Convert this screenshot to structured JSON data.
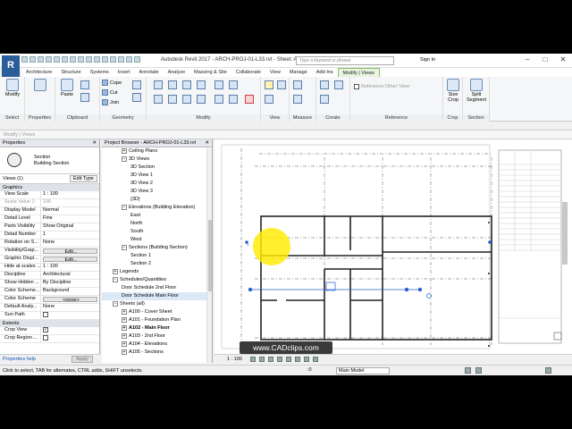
{
  "app": {
    "title": "Autodesk Revit 2017 -  ARCH-PROJ-01-L33.rvt - Sheet: A102 - Main Floor",
    "logo": "R",
    "search_placeholder": "Type a keyword or phrase",
    "sign_in": "Sign In",
    "window_controls": [
      "–",
      "□",
      "✕"
    ]
  },
  "ribbon": {
    "tabs": [
      "Architecture",
      "Structure",
      "Systems",
      "Insert",
      "Annotate",
      "Analyze",
      "Massing & Site",
      "Collaborate",
      "View",
      "Manage",
      "Add-Ins",
      "Modify | Views"
    ],
    "active_tab": "Modify | Views",
    "panels": {
      "select": "Select",
      "properties": "Properties",
      "clipboard": "Clipboard",
      "geometry": "Geometry",
      "modify": "Modify",
      "view": "View",
      "measure": "Measure",
      "create": "Create",
      "reference": "Reference",
      "crop": "Crop",
      "section": "Section"
    },
    "buttons": {
      "modify": "Modify",
      "paste": "Paste",
      "cope": "Cope",
      "cut": "Cut",
      "join": "Join",
      "reference_other_view": "Reference Other View",
      "size_crop": "Size Crop",
      "split_segment": "Split Segment"
    }
  },
  "modify_views_label": "Modify | Views",
  "properties": {
    "header": "Properties",
    "type_name": "Section",
    "type_sub": "Building Section",
    "view_selector": "Views (1)",
    "edit_type": "Edit Type",
    "rows": [
      {
        "k": "Graphics",
        "section": true
      },
      {
        "k": "View Scale",
        "v": "1 : 100"
      },
      {
        "k": "Scale Value   1:",
        "v": "100",
        "grey": true
      },
      {
        "k": "Display Model",
        "v": "Normal"
      },
      {
        "k": "Detail Level",
        "v": "Fine"
      },
      {
        "k": "Parts Visibility",
        "v": "Show Original"
      },
      {
        "k": "Detail Number",
        "v": "1"
      },
      {
        "k": "Rotation on S...",
        "v": "None"
      },
      {
        "k": "Visibility/Grap...",
        "v": "Edit...",
        "btn": true
      },
      {
        "k": "Graphic Displ...",
        "v": "Edit...",
        "btn": true
      },
      {
        "k": "Hide at scales ...",
        "v": "1 : 100"
      },
      {
        "k": "Discipline",
        "v": "Architectural"
      },
      {
        "k": "Show Hidden ...",
        "v": "By Discipline"
      },
      {
        "k": "Color Scheme...",
        "v": "Background"
      },
      {
        "k": "Color Scheme",
        "v": "<none>",
        "btn": true
      },
      {
        "k": "Default Analy...",
        "v": "None"
      },
      {
        "k": "Sun Path",
        "check": false
      },
      {
        "k": "Extents",
        "section": true
      },
      {
        "k": "Crop View",
        "check": true
      },
      {
        "k": "Crop Region ...",
        "check": false
      }
    ],
    "help": "Properties help",
    "apply": "Apply"
  },
  "browser": {
    "header": "Project Browser - ARCH-PROJ-01-L33.rvt",
    "nodes": [
      {
        "t": "Ceiling Plans",
        "d": 1,
        "tg": "+"
      },
      {
        "t": "3D Views",
        "d": 1,
        "tg": "−"
      },
      {
        "t": "3D Section",
        "d": 2
      },
      {
        "t": "3D View 1",
        "d": 2
      },
      {
        "t": "3D View 2",
        "d": 2
      },
      {
        "t": "3D View 3",
        "d": 2
      },
      {
        "t": "{3D}",
        "d": 2
      },
      {
        "t": "Elevations (Building Elevation)",
        "d": 1,
        "tg": "−"
      },
      {
        "t": "East",
        "d": 2
      },
      {
        "t": "North",
        "d": 2
      },
      {
        "t": "South",
        "d": 2
      },
      {
        "t": "West",
        "d": 2
      },
      {
        "t": "Sections (Building Section)",
        "d": 1,
        "tg": "−"
      },
      {
        "t": "Section 1",
        "d": 2
      },
      {
        "t": "Section 2",
        "d": 2
      },
      {
        "t": "Legends",
        "d": 0,
        "tg": "+"
      },
      {
        "t": "Schedules/Quantities",
        "d": 0,
        "tg": "−"
      },
      {
        "t": "Door Schedule 2nd Floor",
        "d": 1
      },
      {
        "t": "Door Schedule Main Floor",
        "d": 1,
        "sel": true
      },
      {
        "t": "Sheets (all)",
        "d": 0,
        "tg": "−"
      },
      {
        "t": "A100 - Cover Sheet",
        "d": 1,
        "tg": "+"
      },
      {
        "t": "A101 - Foundation Plan",
        "d": 1,
        "tg": "+"
      },
      {
        "t": "A102 - Main Floor",
        "d": 1,
        "tg": "+",
        "bold": true
      },
      {
        "t": "A103 - 2nd Floor",
        "d": 1,
        "tg": "+"
      },
      {
        "t": "A104 - Elevations",
        "d": 1,
        "tg": "+"
      },
      {
        "t": "A105 - Sections",
        "d": 1,
        "tg": "+"
      }
    ]
  },
  "view_control": {
    "scale": "1 : 100"
  },
  "status": {
    "message": "Click to select, TAB for alternates, CTRL adds, SHIFT unselects.",
    "model": "Main Model",
    "zero": ":0"
  },
  "watermark": "www.CADclips.com"
}
